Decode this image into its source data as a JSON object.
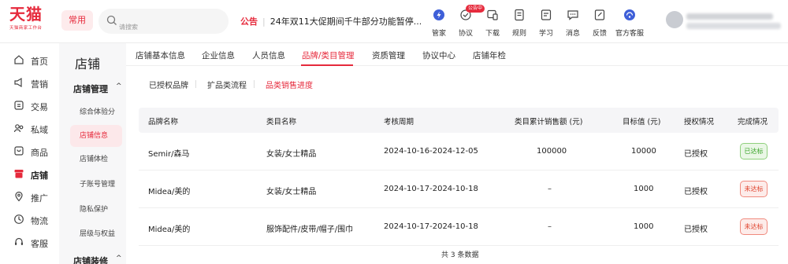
{
  "header": {
    "logo_main": "天猫",
    "logo_sub": "天猫商家工作台",
    "common_label": "常用",
    "search_placeholder": "请搜索",
    "notice_tag": "公告",
    "notice_separator": "|",
    "notice_text": "24年双11大促期间千牛部分功能暂停...",
    "tools": [
      {
        "label": "管家",
        "icon": "butler-icon"
      },
      {
        "label": "协议",
        "icon": "agreement-icon"
      },
      {
        "label": "下载",
        "icon": "download-icon"
      },
      {
        "label": "规则",
        "icon": "rules-icon"
      },
      {
        "label": "学习",
        "icon": "learn-icon"
      },
      {
        "label": "消息",
        "icon": "message-icon"
      },
      {
        "label": "反馈",
        "icon": "feedback-icon"
      },
      {
        "label": "官方客服",
        "icon": "official-service-icon"
      }
    ],
    "agreement_badge": "公告中"
  },
  "nav": {
    "items": [
      {
        "label": "首页",
        "icon": "home-icon"
      },
      {
        "label": "营销",
        "icon": "marketing-icon"
      },
      {
        "label": "交易",
        "icon": "trade-icon"
      },
      {
        "label": "私域",
        "icon": "private-domain-icon"
      },
      {
        "label": "商品",
        "icon": "goods-icon"
      },
      {
        "label": "店铺",
        "icon": "store-icon"
      },
      {
        "label": "推广",
        "icon": "promotion-icon"
      },
      {
        "label": "物流",
        "icon": "logistics-icon"
      },
      {
        "label": "客服",
        "icon": "customer-service-icon"
      }
    ],
    "active_index": 5
  },
  "submenu": {
    "title": "店铺",
    "groups": [
      {
        "label": "店铺管理",
        "chevron": "^"
      },
      {
        "label": "店铺装修",
        "chevron": "^"
      }
    ],
    "items": [
      {
        "label": "综合体验分"
      },
      {
        "label": "店铺信息"
      },
      {
        "label": "店铺体检"
      },
      {
        "label": "子账号管理"
      },
      {
        "label": "隐私保护"
      },
      {
        "label": "层级与权益"
      }
    ],
    "active_index": 1
  },
  "tabs": [
    {
      "label": "店铺基本信息"
    },
    {
      "label": "企业信息"
    },
    {
      "label": "人员信息"
    },
    {
      "label": "品牌/类目管理"
    },
    {
      "label": "资质管理"
    },
    {
      "label": "协议中心"
    },
    {
      "label": "店铺年检"
    }
  ],
  "active_tab": 3,
  "subtabs": [
    {
      "label": "已授权品牌"
    },
    {
      "label": "扩品类流程"
    },
    {
      "label": "品类销售进度"
    }
  ],
  "active_subtab": 2,
  "table": {
    "headers": [
      "品牌名称",
      "类目名称",
      "考核周期",
      "类目累计销售额 (元)",
      "目标值 (元)",
      "授权情况",
      "完成情况"
    ],
    "rows": [
      {
        "brand": "Semir/森马",
        "category": "女装/女士精品",
        "period": "2024-10-16-2024-12-05",
        "sales": "100000",
        "target": "10000",
        "auth": "已授权",
        "status": "已达标",
        "status_type": "ok"
      },
      {
        "brand": "Midea/美的",
        "category": "女装/女士精品",
        "period": "2024-10-17-2024-10-18",
        "sales": "–",
        "target": "1000",
        "auth": "已授权",
        "status": "未达标",
        "status_type": "no"
      },
      {
        "brand": "Midea/美的",
        "category": "服饰配件/皮带/帽子/围巾",
        "period": "2024-10-17-2024-10-18",
        "sales": "–",
        "target": "1000",
        "auth": "已授权",
        "status": "未达标",
        "status_type": "no"
      }
    ],
    "footer": "共 3 条数据"
  },
  "colors": {
    "accent": "#e62a3c",
    "ok": "#3ba32a",
    "fail": "#e0442f"
  }
}
